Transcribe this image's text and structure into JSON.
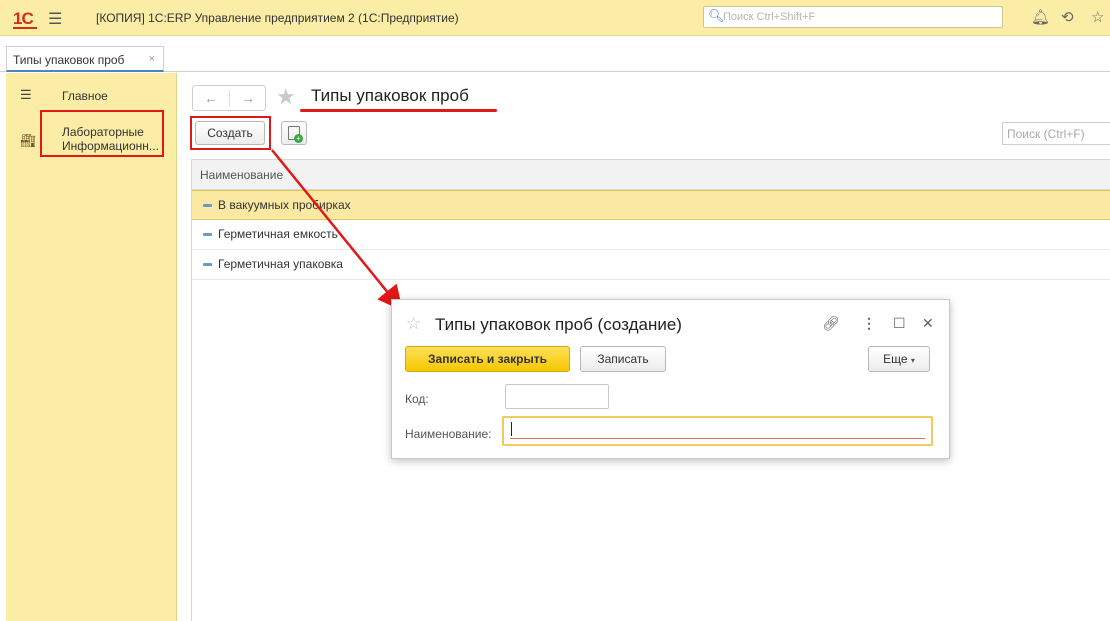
{
  "titlebar": {
    "logo": "1C",
    "app_title": "[КОПИЯ] 1С:ERP Управление предприятием 2  (1С:Предприятие)",
    "search_placeholder": "Поиск Ctrl+Shift+F"
  },
  "tabs": [
    {
      "label": "Типы упаковок проб",
      "close": "×"
    }
  ],
  "sidebar": {
    "items": [
      {
        "label": "Главное",
        "icon": "hamburger-icon"
      },
      {
        "label": "Лабораторные Информационн...",
        "line1": "Лабораторные",
        "line2": "Информационн...",
        "icon": "lab-icon"
      }
    ]
  },
  "main": {
    "title": "Типы упаковок проб",
    "create_label": "Создать",
    "search_placeholder": "Поиск (Ctrl+F)",
    "column_header": "Наименование",
    "rows": [
      {
        "name": "В вакуумных пробирках",
        "selected": true
      },
      {
        "name": "Герметичная емкость",
        "selected": false
      },
      {
        "name": "Герметичная упаковка",
        "selected": false
      }
    ]
  },
  "dialog": {
    "title": "Типы упаковок проб (создание)",
    "save_close_label": "Записать и закрыть",
    "save_label": "Записать",
    "more_label": "Еще",
    "code_label": "Код:",
    "code_value": "",
    "name_label": "Наименование:",
    "name_value": ""
  },
  "colors": {
    "titlebar_bg": "#fbeda6",
    "accent_red": "#e01818",
    "selected_row": "#fbe8a3",
    "primary_button": "#f5c800"
  }
}
